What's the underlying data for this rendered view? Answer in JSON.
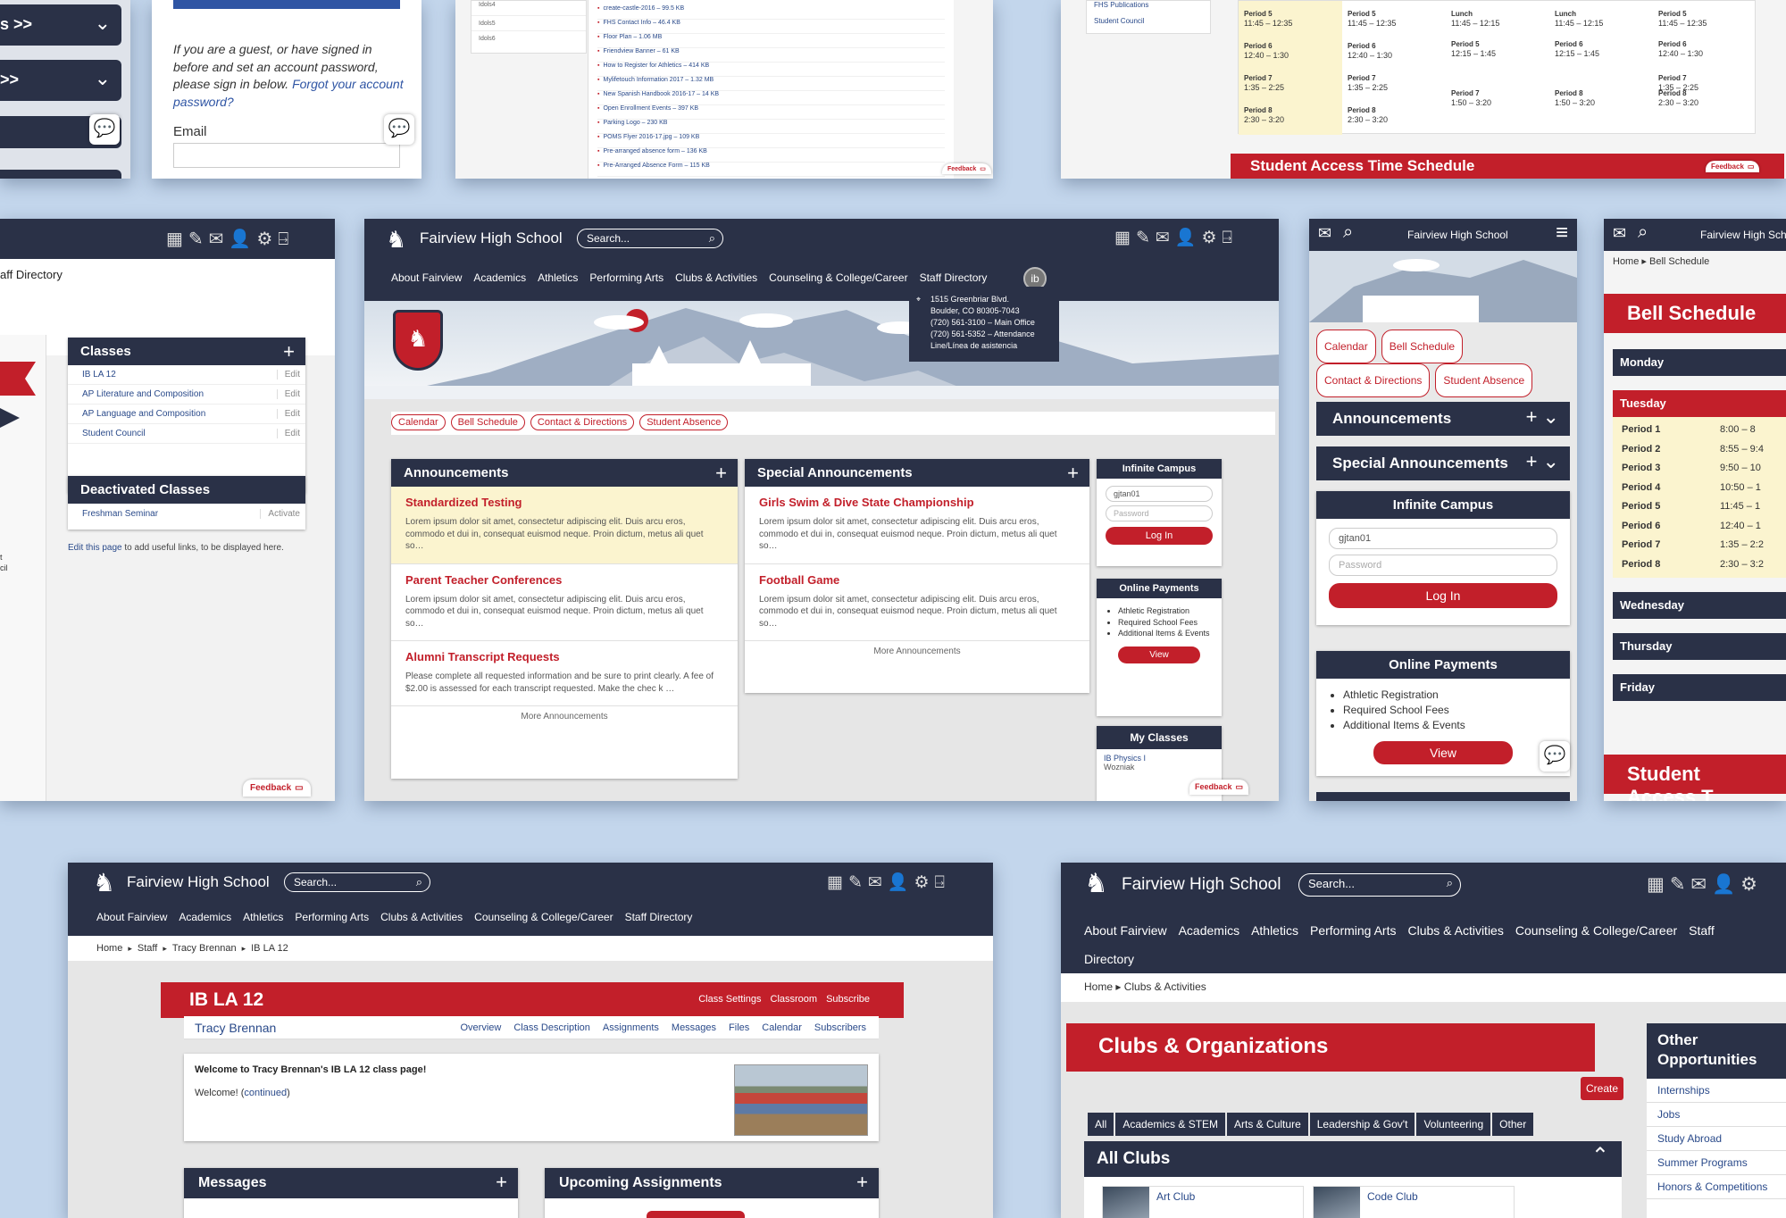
{
  "school_name": "Fairview High School",
  "search_placeholder": "Search...",
  "nav_items": [
    "About Fairview",
    "Academics",
    "Athletics",
    "Performing Arts",
    "Clubs & Activities",
    "Counseling & College/Career",
    "Staff Directory"
  ],
  "quick_links": [
    "Calendar",
    "Bell Schedule",
    "Contact & Directions",
    "Student Absence"
  ],
  "contact": {
    "addr1": "1515 Greenbriar Blvd.",
    "addr2": "Boulder, CO 80305-7043",
    "phone1": "(720) 561-3100  –  Main Office",
    "phone2": "(720) 561-5352  –  Attendance",
    "phone2b": "Line/Línea de asistencia"
  },
  "announcements": {
    "title": "Announcements",
    "items": [
      {
        "title": "Standardized Testing",
        "body": "Lorem ipsum dolor sit amet, consectetur adipiscing elit. Duis arcu eros, commodo et dui in, consequat euismod neque. Proin dictum, metus ali quet so…"
      },
      {
        "title": "Parent Teacher Conferences",
        "body": "Lorem ipsum dolor sit amet, consectetur adipiscing elit. Duis arcu eros, commodo et dui in, consequat euismod neque. Proin dictum, metus ali quet so…"
      },
      {
        "title": "Alumni Transcript Requests",
        "body": "Please complete all requested information and be sure to print clearly. A fee of $2.00 is assessed for each transcript requested. Make the chec k …"
      }
    ],
    "more": "More Announcements"
  },
  "special": {
    "title": "Special Announcements",
    "items": [
      {
        "title": "Girls Swim & Dive State Championship",
        "body": "Lorem ipsum dolor sit amet, consectetur adipiscing elit. Duis arcu eros, commodo et dui in, consequat euismod neque. Proin dictum, metus ali quet so…"
      },
      {
        "title": "Football Game",
        "body": "Lorem ipsum dolor sit amet, consectetur adipiscing elit. Duis arcu eros, commodo et dui in, consequat euismod neque. Proin dictum, metus ali quet so…"
      }
    ],
    "more": "More Announcements"
  },
  "campus": {
    "title": "Infinite Campus",
    "username": "gjtan01",
    "password_placeholder": "Password",
    "login": "Log In"
  },
  "payments": {
    "title": "Online Payments",
    "items": [
      "Athletic Registration",
      "Required School Fees",
      "Additional Items & Events"
    ],
    "view": "View"
  },
  "my_classes": {
    "title": "My Classes",
    "item": "IB Physics I",
    "teacher": "Wozniak"
  },
  "feedback": "Feedback",
  "classes_panel": {
    "staff_dir": "aff Directory",
    "title": "Classes",
    "items": [
      "IB LA 12",
      "AP Literature and Composition",
      "AP Language and Composition",
      "Student Council"
    ],
    "edit": "Edit",
    "deact_title": "Deactivated Classes",
    "deact_item": "Freshman Seminar",
    "activate": "Activate",
    "edit_link": "Edit this page",
    "edit_note": " to add useful links, to be displayed here.",
    "left_a": "t",
    "left_b": "cil"
  },
  "login_panel": {
    "text": "If you are a guest, or have signed in before and set an account password, please sign in below. ",
    "link": "Forgot your account password?",
    "email": "Email"
  },
  "left_top": {
    "a": "s >>",
    "b": ">>"
  },
  "files": {
    "folders": [
      "Idols4",
      "Idols5",
      "Idols6"
    ],
    "items": [
      "create-castle-2016 – 99.5 KB",
      "FHS Contact Info – 46.4 KB",
      "Floor Plan – 1.06 MB",
      "Friendview Banner – 61 KB",
      "How to Register for Athletics – 414 KB",
      "Mylifetouch Information 2017 – 1.32 MB",
      "New Spanish Handbook 2016-17 – 14 KB",
      "Open Enrollment Events – 397 KB",
      "Parking Logo – 230 KB",
      "POMS Flyer 2016-17.jpg – 109 KB",
      "Pre-arranged absence form – 136 KB",
      "Pre-Arranged Absence Form – 115 KB"
    ]
  },
  "pubs": {
    "a": "FHS Publications",
    "b": "Student Council"
  },
  "schedule": {
    "footer": "Student Access Time Schedule",
    "cols": [
      [
        [
          "Period 5",
          "11:45 – 12:35"
        ],
        [
          "Period 6",
          "12:40 – 1:30"
        ],
        [
          "Period 7",
          "1:35 – 2:25"
        ],
        [
          "Period 8",
          "2:30 – 3:20"
        ]
      ],
      [
        [
          "Period 5",
          "11:45 – 12:35"
        ],
        [
          "Period 6",
          "12:40 – 1:30"
        ],
        [
          "Period 7",
          "1:35 – 2:25"
        ],
        [
          "Period 8",
          "2:30 – 3:20"
        ]
      ],
      [
        [
          "Lunch",
          "11:45 – 12:15"
        ],
        [
          "Period 5",
          "12:15 – 1:45"
        ],
        [
          "",
          ""
        ],
        [
          "Period 7",
          "1:50 – 3:20"
        ]
      ],
      [
        [
          "Lunch",
          "11:45 – 12:15"
        ],
        [
          "Period 6",
          "12:15 – 1:45"
        ],
        [
          "",
          ""
        ],
        [
          "Period 8",
          "1:50 – 3:20"
        ]
      ],
      [
        [
          "Period 5",
          "11:45 – 12:35"
        ],
        [
          "Period 6",
          "12:40 – 1:30"
        ],
        [
          "Period 7",
          "1:35 – 2:25"
        ],
        [
          "Period 8",
          "2:30 – 3:20"
        ]
      ]
    ]
  },
  "mobile": {
    "announce": "Announcements",
    "special": "Special Announcements"
  },
  "bell": {
    "crumb_home": "Home",
    "crumb_page": "Bell Schedule",
    "title": "Bell Schedule",
    "days": [
      "Monday",
      "Tuesday",
      "Wednesday",
      "Thursday",
      "Friday"
    ],
    "periods": [
      [
        "Period 1",
        "8:00 – 8"
      ],
      [
        "Period 2",
        "8:55 – 9:4"
      ],
      [
        "Period 3",
        "9:50 – 10"
      ],
      [
        "Period 4",
        "10:50 – 1"
      ],
      [
        "Period 5",
        "11:45 – 1"
      ],
      [
        "Period 6",
        "12:40 – 1"
      ],
      [
        "Period 7",
        "1:35 – 2:2"
      ],
      [
        "Period 8",
        "2:30 – 3:2"
      ]
    ],
    "footer": "Student Access T"
  },
  "classpage": {
    "crumbs": [
      "Home",
      "Staff",
      "Tracy Brennan",
      "IB LA 12"
    ],
    "title": "IB LA 12",
    "actions": [
      "Class Settings",
      "Classroom",
      "Subscribe"
    ],
    "teacher": "Tracy Brennan",
    "tabs": [
      "Overview",
      "Class Description",
      "Assignments",
      "Messages",
      "Files",
      "Calendar",
      "Subscribers"
    ],
    "welcome": "Welcome to Tracy Brennan's IB LA 12 class page!",
    "welcome2": "Welcome! (",
    "cont": "continued",
    "close": ")",
    "messages": "Messages",
    "upcoming": "Upcoming Assignments"
  },
  "clubs": {
    "crumb_home": "Home",
    "crumb_page": "Clubs & Activities",
    "title": "Clubs & Organizations",
    "create": "Create",
    "tabs": [
      "All",
      "Academics & STEM",
      "Arts & Culture",
      "Leadership & Gov't",
      "Volunteering",
      "Other"
    ],
    "all": "All Clubs",
    "clubs": [
      "Art Club",
      "Code Club"
    ],
    "other_title": "Other Opportunities",
    "other": [
      "Internships",
      "Jobs",
      "Study Abroad",
      "Summer Programs",
      "Honors & Competitions"
    ]
  }
}
